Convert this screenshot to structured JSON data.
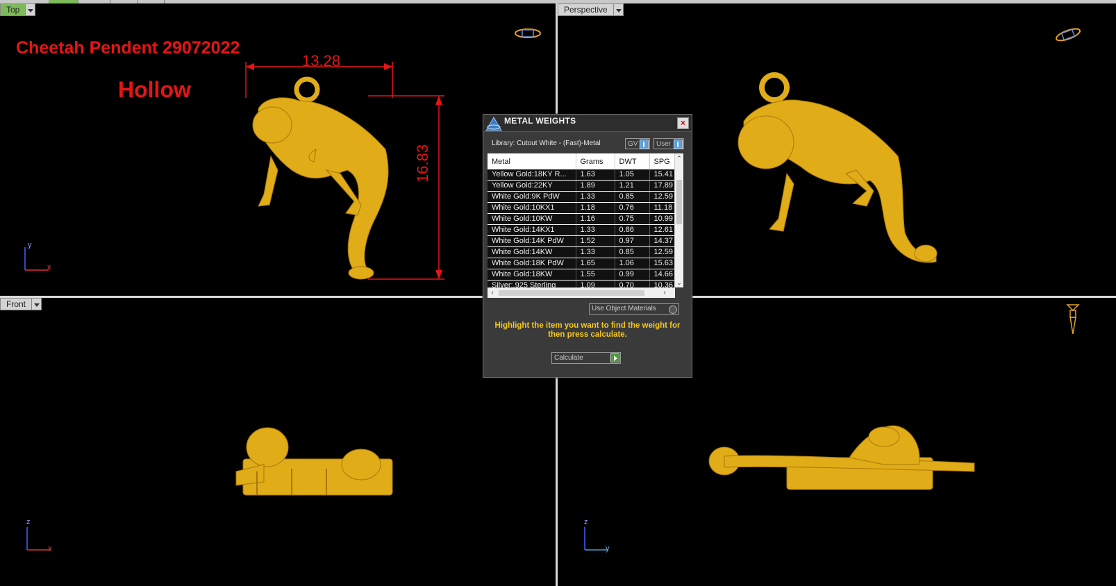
{
  "viewports": {
    "top": {
      "label": "Top"
    },
    "perspective": {
      "label": "Perspective"
    },
    "front": {
      "label": "Front"
    }
  },
  "annotations": {
    "title": "Cheetah Pendent 29072022",
    "subtitle": "Hollow",
    "width_dim": "13.28",
    "height_dim": "16.83"
  },
  "axes": {
    "top": {
      "v": "y",
      "h": "x"
    },
    "front": {
      "v": "z",
      "h": "x"
    },
    "right": {
      "v": "z",
      "h": "y"
    }
  },
  "dialog": {
    "title": "METAL WEIGHTS",
    "library": "Library: Cutout White - (Fast)-Metal",
    "gv_label": "GV",
    "user_label": "User",
    "columns": [
      "Metal",
      "Grams",
      "DWT",
      "SPG"
    ],
    "rows": [
      [
        "Yellow Gold:18KY R...",
        "1.63",
        "1.05",
        "15.41"
      ],
      [
        "Yellow Gold:22KY",
        "1.89",
        "1.21",
        "17.89"
      ],
      [
        "White Gold:9K PdW",
        "1.33",
        "0.85",
        "12.59"
      ],
      [
        "White Gold:10KX1",
        "1.18",
        "0.76",
        "11.18"
      ],
      [
        "White Gold:10KW",
        "1.16",
        "0.75",
        "10.99"
      ],
      [
        "White Gold:14KX1",
        "1.33",
        "0.86",
        "12.61"
      ],
      [
        "White Gold:14K PdW",
        "1.52",
        "0.97",
        "14.37"
      ],
      [
        "White Gold:14KW",
        "1.33",
        "0.85",
        "12.59"
      ],
      [
        "White Gold:18K PdW",
        "1.65",
        "1.06",
        "15.63"
      ],
      [
        "White Gold:18KW",
        "1.55",
        "0.99",
        "14.66"
      ],
      [
        "Silver:.925 Sterling",
        "1.09",
        "0.70",
        "10.36"
      ]
    ],
    "use_object_materials": "Use Object Materials",
    "hint": "Highlight the item you want to find the weight for then press calculate.",
    "calculate_label": "Calculate"
  },
  "colors": {
    "annotation_red": "#e81414",
    "gold": "#e8b820",
    "hint_yellow": "#f5c820"
  }
}
